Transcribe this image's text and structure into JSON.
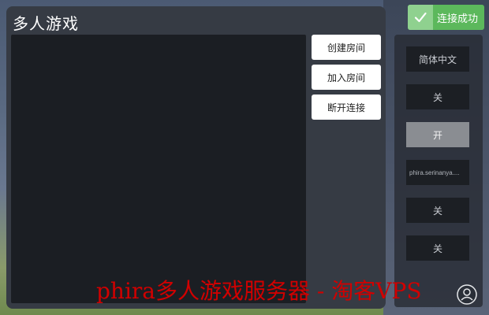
{
  "dialog": {
    "title": "多人游戏",
    "actions": [
      {
        "label": "创建房间"
      },
      {
        "label": "加入房间"
      },
      {
        "label": "断开连接"
      }
    ]
  },
  "toast": {
    "text": "连接成功",
    "icon": "check-icon",
    "color": "#5cb85c"
  },
  "settings": [
    {
      "value": "简体中文"
    },
    {
      "value": "关"
    },
    {
      "value": "开",
      "active": true
    },
    {
      "value": "phira.serinanya...."
    },
    {
      "value": "关"
    },
    {
      "value": "关"
    }
  ],
  "watermark": {
    "text": "phira多人游戏服务器 - 淘客VPS"
  },
  "colors": {
    "dialog_bg": "#363b44",
    "log_bg": "#1b1e23",
    "accent_success": "#5cb85c",
    "watermark": "#d10000"
  }
}
